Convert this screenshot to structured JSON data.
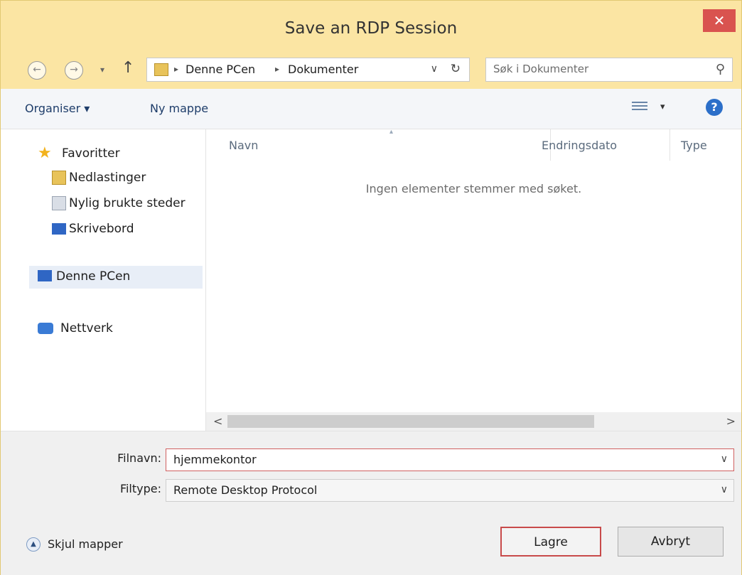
{
  "window": {
    "title": "Save an RDP Session",
    "close_glyph": "✕"
  },
  "nav_buttons": {
    "back_glyph": "←",
    "forward_glyph": "→",
    "recent_glyph": "▾",
    "up_glyph": "↑"
  },
  "address": {
    "crumbs": [
      "Denne PCen",
      "Dokumenter"
    ],
    "arrow_glyph": "▸",
    "dropdown_glyph": "∨",
    "refresh_glyph": "↻"
  },
  "search": {
    "placeholder": "Søk i Dokumenter",
    "icon_glyph": "⚲"
  },
  "toolbar": {
    "organize_label": "Organiser ▾",
    "new_folder_label": "Ny mappe",
    "view_dd_glyph": "▾",
    "help_glyph": "?"
  },
  "navpane": {
    "favorites": "Favoritter",
    "downloads": "Nedlastinger",
    "recent_places": "Nylig brukte steder",
    "desktop": "Skrivebord",
    "this_pc": "Denne PCen",
    "network": "Nettverk"
  },
  "icons": {
    "favorites": "star-icon",
    "downloads": "downloads-folder-icon",
    "recent_places": "recent-places-icon",
    "desktop": "desktop-icon",
    "this_pc": "computer-icon",
    "network": "network-icon",
    "search": "search-icon",
    "help": "help-icon",
    "view": "view-options-icon"
  },
  "content": {
    "columns": [
      "Navn",
      "Endringsdato",
      "Type"
    ],
    "sort_glyph": "▴",
    "empty_message": "Ingen elementer stemmer med søket."
  },
  "scrollbar": {
    "left_glyph": "<",
    "right_glyph": ">"
  },
  "form": {
    "filename_label": "Filnavn:",
    "filename_value": "hjemmekontor",
    "filetype_label": "Filtype:",
    "filetype_value": "Remote Desktop Protocol",
    "dropdown_glyph": "∨"
  },
  "footer": {
    "hide_folders_label": "Skjul mapper",
    "hide_glyph": "▲",
    "save_label": "Lagre",
    "cancel_label": "Avbryt"
  },
  "colors": {
    "titlebar": "#fbe5a3",
    "close_button": "#d9534f",
    "selection": "#e8eef7",
    "link_text": "#1e3d6a"
  }
}
